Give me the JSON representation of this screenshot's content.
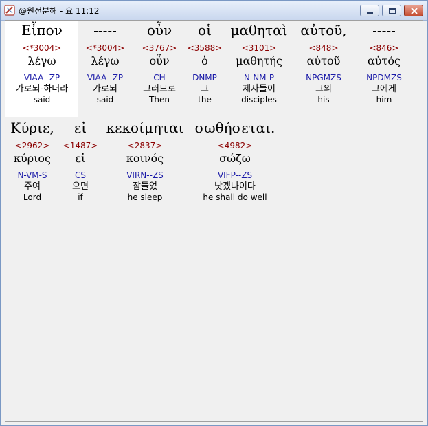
{
  "window": {
    "title": "@원전분해 - 요 11:12"
  },
  "rows": [
    [
      {
        "greek": "Εἶπον",
        "strong": "<*3004>",
        "lemma": "λέγω",
        "parse": "VIAA--ZP",
        "korean": "가로되-하더라",
        "english": "said"
      },
      {
        "greek": "-----",
        "strong": "<*3004>",
        "lemma": "λέγω",
        "parse": "VIAA--ZP",
        "korean": "가로되",
        "english": "said"
      },
      {
        "greek": "οὖν",
        "strong": "<3767>",
        "lemma": "οὖν",
        "parse": "CH",
        "korean": "그러므로",
        "english": "Then"
      },
      {
        "greek": "οἱ",
        "strong": "<3588>",
        "lemma": "ὁ",
        "parse": "DNMP",
        "korean": "그",
        "english": "the"
      },
      {
        "greek": "μαθηταὶ",
        "strong": "<3101>",
        "lemma": "μαθητής",
        "parse": "N-NM-P",
        "korean": "제자들이",
        "english": "disciples"
      },
      {
        "greek": "αὐτοῦ,",
        "strong": "<848>",
        "lemma": "αὐτοῦ",
        "parse": "NPGMZS",
        "korean": "그의",
        "english": "his"
      },
      {
        "greek": "-----",
        "strong": "<846>",
        "lemma": "αὐτός",
        "parse": "NPDMZS",
        "korean": "그에게",
        "english": "him"
      }
    ],
    [
      {
        "greek": "Κύριε,",
        "strong": "<2962>",
        "lemma": "κύριος",
        "parse": "N-VM-S",
        "korean": "주여",
        "english": "Lord"
      },
      {
        "greek": "εἰ",
        "strong": "<1487>",
        "lemma": "εἰ",
        "parse": "CS",
        "korean": "으면",
        "english": "if"
      },
      {
        "greek": "κεκοίμηται",
        "strong": "<2837>",
        "lemma": "κοινός",
        "parse": "VIRN--ZS",
        "korean": "잠들었",
        "english": "he sleep"
      },
      {
        "greek": "σωθήσεται.",
        "strong": "<4982>",
        "lemma": "σώζω",
        "parse": "VIFP--ZS",
        "korean": "낫겠나이다",
        "english": "he shall do well"
      }
    ]
  ]
}
